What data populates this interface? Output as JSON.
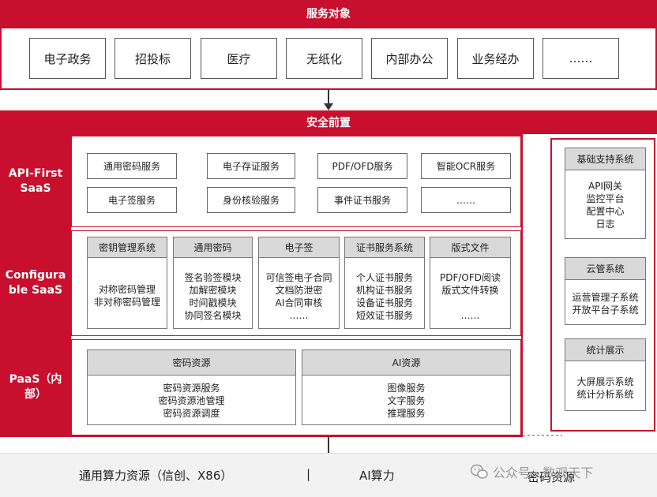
{
  "service_target": {
    "title": "服务对象",
    "items": [
      "电子政务",
      "招投标",
      "医疗",
      "无纸化",
      "内部办公",
      "业务经办",
      "……"
    ]
  },
  "security_front": {
    "title": "安全前置"
  },
  "api_first": {
    "label": "API-First SaaS",
    "row1": [
      "通用密码服务",
      "电子存证服务",
      "PDF/OFD服务",
      "智能OCR服务"
    ],
    "row2": [
      "电子签服务",
      "身份核验服务",
      "事件证书服务",
      "……"
    ]
  },
  "configurable": {
    "label": "Configurable SaaS",
    "modules": [
      {
        "title": "密钥管理系统",
        "lines": [
          "对称密码管理",
          "非对称密码管理"
        ]
      },
      {
        "title": "通用密码",
        "lines": [
          "签名验签模块",
          "加解密模块",
          "时间戳模块",
          "协同签名模块"
        ]
      },
      {
        "title": "电子签",
        "lines": [
          "可信签电子合同",
          "文档防泄密",
          "AI合同审核",
          "……"
        ]
      },
      {
        "title": "证书服务系统",
        "lines": [
          "个人证书服务",
          "机构证书服务",
          "设备证书服务",
          "短效证书服务"
        ]
      },
      {
        "title": "版式文件",
        "lines": [
          "PDF/OFD阅读",
          "版式文件转换",
          "",
          "……"
        ]
      }
    ]
  },
  "paas": {
    "label": "PaaS（内部）",
    "resources": [
      {
        "title": "密码资源",
        "lines": [
          "密码资源服务",
          "密码资源池管理",
          "密码资源调度"
        ]
      },
      {
        "title": "AI资源",
        "lines": [
          "图像服务",
          "文字服务",
          "推理服务"
        ]
      }
    ]
  },
  "side": {
    "boxes": [
      {
        "title": "基础支持系统",
        "lines": [
          "API网关",
          "监控平台",
          "配置中心",
          "日志"
        ]
      },
      {
        "title": "云管系统",
        "lines": [
          "运营管理子系统",
          "开放平台子系统"
        ]
      },
      {
        "title": "统计展示",
        "lines": [
          "大屏展示系统",
          "统计分析系统"
        ]
      }
    ]
  },
  "bottom": {
    "items": [
      "通用算力资源（信创、X86）",
      "AI算力",
      "密码资源"
    ],
    "separator": "|"
  },
  "watermark": {
    "text": "公众号 · 数观天下",
    "icon": "wechat-icon"
  },
  "colors": {
    "accent": "#c8102e",
    "module_header": "#d9d9d9"
  }
}
